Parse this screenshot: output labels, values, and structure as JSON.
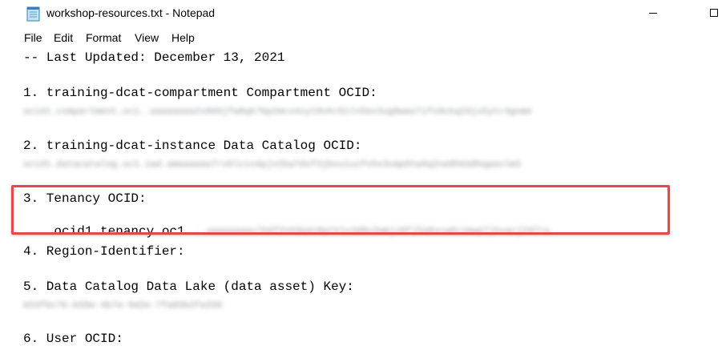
{
  "window": {
    "title": "workshop-resources.txt - Notepad",
    "app_icon": "notepad-icon"
  },
  "menu": [
    "File",
    "Edit",
    "Format",
    "View",
    "Help"
  ],
  "editor": {
    "updated_line": "-- Last Updated: December 13, 2021",
    "item1_label": "1. training-dcat-compartment Compartment OCID:",
    "item1_value_blurred": "ocid1.compartment.oc1..aaaaaaaa2x9d4jfw8qk7bp2mcs4zyt0vhr61ln5ex3ug8wao7ifs9ckq2dju5ytr4gnme",
    "item2_label": "2. training-dcat-instance Data Catalog OCID:",
    "item2_value_blurred": "ocid1.datacatalog.oc1.iad.amaaaaaa7rx6lcis4pjv2kw7dsf3jbvuiuzfv5s3xmp9tw4q2ne8hkb8hqpaxlm3",
    "item3_label": "3. Tenancy OCID:",
    "item3_value_prefix": "ocid1.tenancy.oc1",
    "item3_value_blurred": "..aaaaaaaav7k6f2nh9q4z8ptk1x3d8u2wmjz0fj5a8vcw6czmwp7jhvacj2d7ra",
    "item4_label": "4. Region-Identifier:",
    "item5_label": "5. Data Catalog Data Lake (data asset) Key:",
    "item5_value_blurred": "b53fbc76-b58e-4b7e-9d2e-7fa83b2fa336",
    "item6_label": "6. User OCID:"
  },
  "colors": {
    "highlight_border": "#e8474a",
    "text": "#000000",
    "background": "#ffffff"
  }
}
